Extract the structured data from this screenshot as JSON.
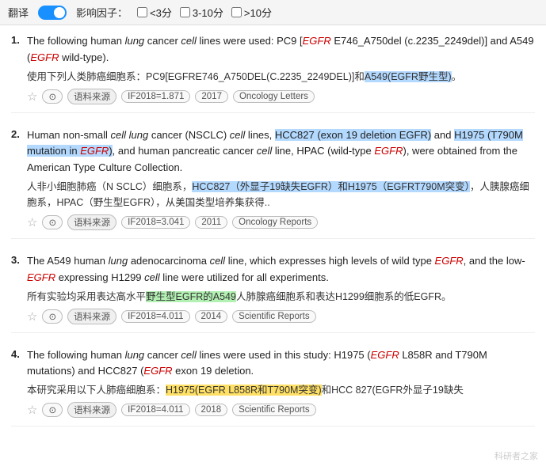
{
  "topbar": {
    "toggle_label": "翻译",
    "filter_label": "影响因子：",
    "filters": [
      {
        "label": "<3分",
        "checked": false
      },
      {
        "label": "3-10分",
        "checked": false
      },
      {
        "label": ">10分",
        "checked": false
      }
    ]
  },
  "results": [
    {
      "number": "1.",
      "en_text_parts": [
        {
          "text": "The following human "
        },
        {
          "text": "lung",
          "italic": true
        },
        {
          "text": " cancer "
        },
        {
          "text": "cell",
          "italic": true
        },
        {
          "text": " lines were used: PC9 ["
        },
        {
          "text": "EGFR",
          "egfr": true
        },
        {
          "text": " E746_A750del (c.2235_2249del)] and A549 ("
        },
        {
          "text": "EGFR",
          "egfr": true
        },
        {
          "text": " wild-type)."
        }
      ],
      "cn_text_parts": [
        {
          "text": "使用下列人类肺癌细胞系：PC9[EGFRE746_A750DEL(C.2235_2249DEL)]和"
        },
        {
          "text": "A549(EGFR野生型)",
          "highlight": "blue"
        },
        {
          "text": "。"
        }
      ],
      "meta": {
        "if_value": "IF2018=1.871",
        "year": "2017",
        "journal": "Oncology Letters"
      }
    },
    {
      "number": "2.",
      "en_text_parts": [
        {
          "text": "Human non-small "
        },
        {
          "text": "cell",
          "italic": true
        },
        {
          "text": " "
        },
        {
          "text": "lung",
          "italic": true
        },
        {
          "text": " cancer (NSCLC) "
        },
        {
          "text": "cell",
          "italic": true
        },
        {
          "text": " lines, "
        },
        {
          "text": "HCC827 (exon 19 deletion EGF",
          "highlight": "blue"
        },
        {
          "text": "R)",
          "highlight": "blue"
        },
        {
          "text": " and "
        },
        {
          "text": "H1975 (T790M mutation in ",
          "highlight": "blue"
        },
        {
          "text": "EGFR",
          "egfr": true,
          "highlight": "blue"
        },
        {
          "text": ")",
          "highlight": "blue"
        },
        {
          "text": ", and human pancreatic cancer "
        },
        {
          "text": "cell",
          "italic": true
        },
        {
          "text": " line, HPAC (wild-type "
        },
        {
          "text": "EGFR",
          "egfr": true
        },
        {
          "text": "), were obtained from the American Type Culture Collection."
        }
      ],
      "cn_text_parts": [
        {
          "text": "人非小细胞肺癌（N SCLC）细胞系，"
        },
        {
          "text": "HCC827（外显子19缺失EGFR）和H1975（EGFR",
          "highlight": "blue"
        },
        {
          "text": "T790M突变）",
          "highlight": "blue"
        },
        {
          "text": "，人胰腺癌细胞系，HPAC（野生型EGFR），从美国类型培养集获得.."
        }
      ],
      "meta": {
        "if_value": "IF2018=3.041",
        "year": "2011",
        "journal": "Oncology Reports"
      }
    },
    {
      "number": "3.",
      "en_text_parts": [
        {
          "text": "The A549 human "
        },
        {
          "text": "lung",
          "italic": true
        },
        {
          "text": " adenocarcinoma "
        },
        {
          "text": "cell",
          "italic": true
        },
        {
          "text": " line, which expresses high levels of wild type "
        },
        {
          "text": "EGFR",
          "egfr": true
        },
        {
          "text": ", and the low-"
        },
        {
          "text": "EGFR",
          "egfr": true
        },
        {
          "text": " expressing H1299 "
        },
        {
          "text": "cell",
          "italic": true
        },
        {
          "text": " line were utilized for all experiments."
        }
      ],
      "cn_text_parts": [
        {
          "text": "所有实验均采用表达高水平"
        },
        {
          "text": "野生型EGFR的A549",
          "highlight": "green"
        },
        {
          "text": "人肺腺癌细胞系和表达H1299细胞系的低EGFR。"
        }
      ],
      "meta": {
        "if_value": "IF2018=4.011",
        "year": "2014",
        "journal": "Scientific Reports"
      }
    },
    {
      "number": "4.",
      "en_text_parts": [
        {
          "text": "The following human "
        },
        {
          "text": "lung",
          "italic": true
        },
        {
          "text": " cancer "
        },
        {
          "text": "cell",
          "italic": true
        },
        {
          "text": " lines were used in this study: H1975 ("
        },
        {
          "text": "EGFR",
          "egfr": true
        },
        {
          "text": " L858R and T790M mutations) and HCC827 ("
        },
        {
          "text": "EGFR",
          "egfr": true
        },
        {
          "text": " exon 19 deletion."
        }
      ],
      "cn_text_parts": [
        {
          "text": "本研究采用以下人肺癌细胞系："
        },
        {
          "text": "H1975(EGFR L858R和T790M突变)",
          "highlight": "yellow"
        },
        {
          "text": "和HCC 827(EGFR外显子19缺失"
        }
      ],
      "meta": {
        "if_value": "IF2018=4.011",
        "year": "2018",
        "journal": "Scientific Reports"
      }
    }
  ],
  "watermark": "科研者之家"
}
